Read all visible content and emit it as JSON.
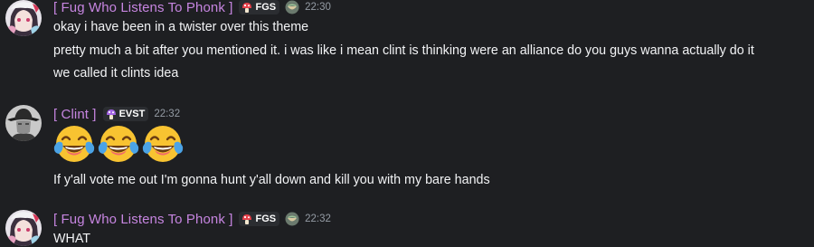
{
  "messages": [
    {
      "author": "[ Fug Who Listens To Phonk ]",
      "tag": "FGS",
      "time": "22:30",
      "lines": [
        "okay i have been in a twister over this theme",
        "pretty much a bit after you mentioned it. i was like i mean clint is thinking were an alliance do you guys wanna actually do it",
        "we called it clints idea"
      ]
    },
    {
      "author": "[ Clint ]",
      "tag": "EVST",
      "time": "22:32",
      "emoji_count": 3,
      "lines": [
        "If y'all vote me out I'm gonna hunt y'all down and kill you with my bare hands"
      ]
    },
    {
      "author": "[ Fug Who Listens To Phonk ]",
      "tag": "FGS",
      "time": "22:32",
      "lines": [
        "WHAT"
      ]
    }
  ],
  "icons": {
    "fgs_tag": "mushroom-icon",
    "evst_tag": "mushroom-icon",
    "badge": "bowl-icon",
    "reaction": "joy-tears-emoji"
  },
  "colors": {
    "background": "#1e1f22",
    "username": "#c685e0",
    "timestamp": "#949ba4",
    "text": "#f2f3f5"
  }
}
